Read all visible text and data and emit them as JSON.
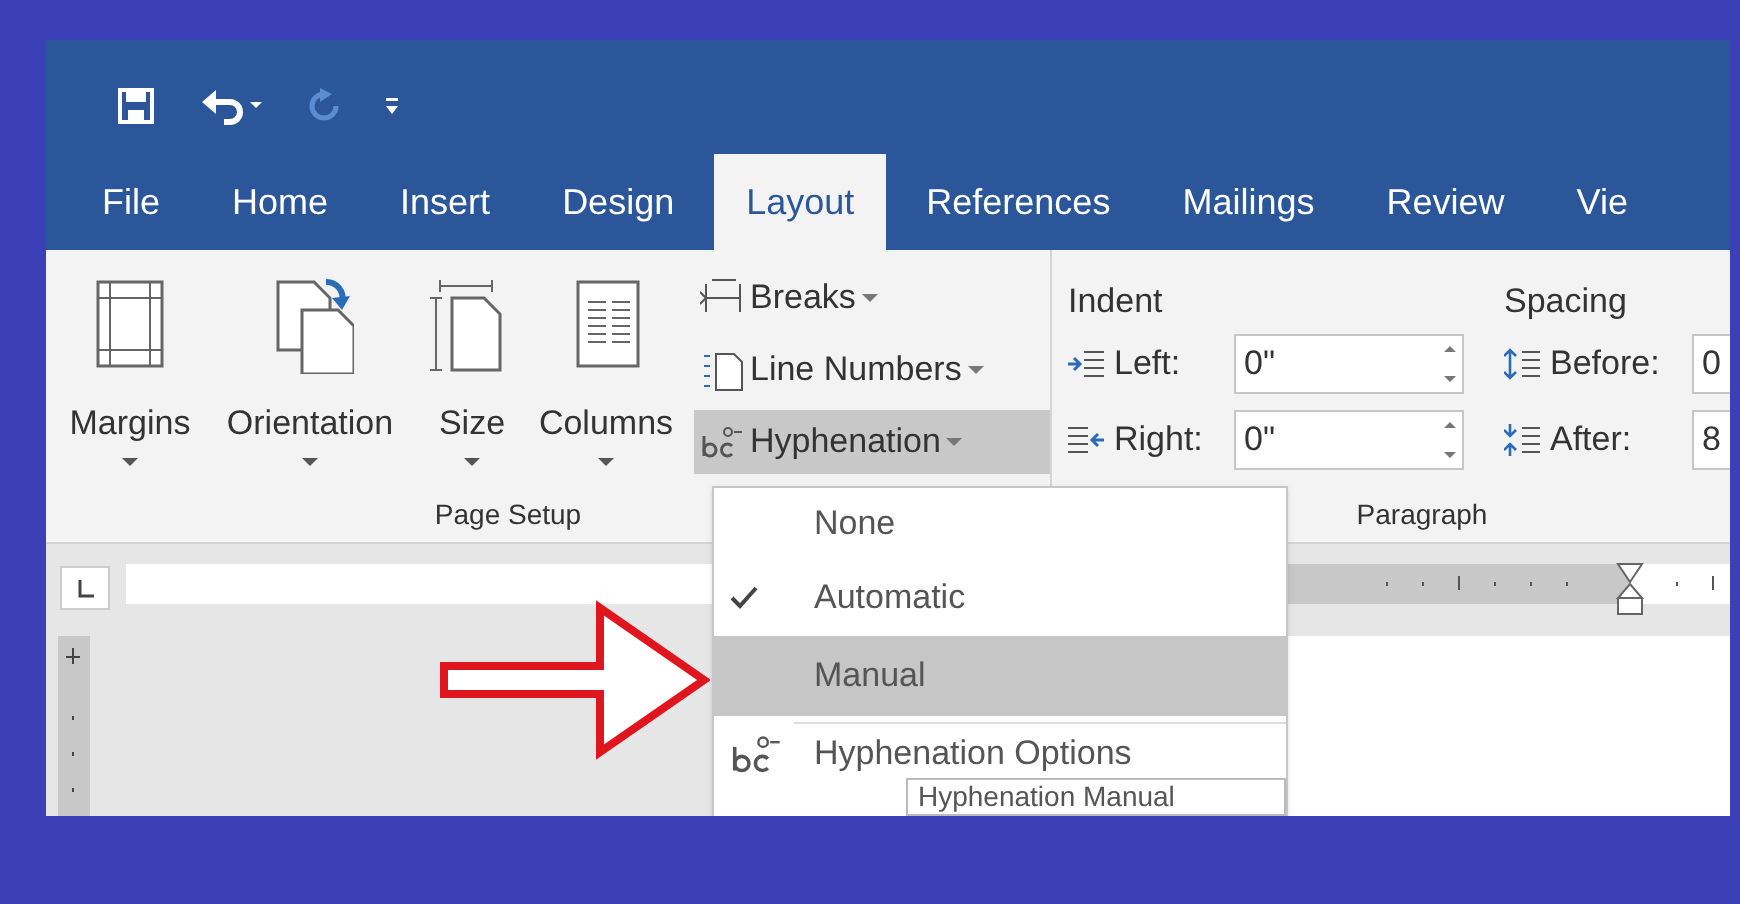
{
  "tabs": [
    {
      "label": "File",
      "selected": false
    },
    {
      "label": "Home",
      "selected": false
    },
    {
      "label": "Insert",
      "selected": false
    },
    {
      "label": "Design",
      "selected": false
    },
    {
      "label": "Layout",
      "selected": true
    },
    {
      "label": "References",
      "selected": false
    },
    {
      "label": "Mailings",
      "selected": false
    },
    {
      "label": "Review",
      "selected": false
    },
    {
      "label": "Vie",
      "selected": false
    }
  ],
  "page_setup": {
    "label": "Page Setup",
    "large_buttons": [
      {
        "kind": "margins",
        "label": "Margins"
      },
      {
        "kind": "orientation",
        "label": "Orientation"
      },
      {
        "kind": "size",
        "label": "Size"
      },
      {
        "kind": "columns",
        "label": "Columns"
      }
    ],
    "small_buttons": [
      {
        "kind": "breaks",
        "label": "Breaks",
        "expanded": false
      },
      {
        "kind": "line_numbers",
        "label": "Line Numbers",
        "expanded": false
      },
      {
        "kind": "hyphenation",
        "label": "Hyphenation",
        "expanded": true
      }
    ]
  },
  "paragraph": {
    "label": "Paragraph",
    "indent": {
      "heading": "Indent",
      "fields": [
        {
          "kind": "left",
          "label": "Left:",
          "value": "0\""
        },
        {
          "kind": "right",
          "label": "Right:",
          "value": "0\""
        }
      ]
    },
    "spacing": {
      "heading": "Spacing",
      "fields": [
        {
          "kind": "before",
          "label": "Before:",
          "value": "0"
        },
        {
          "kind": "after",
          "label": "After:",
          "value": "8"
        }
      ]
    }
  },
  "hyphenation_menu": {
    "items": [
      {
        "kind": "option",
        "label": "None",
        "checked": false,
        "selected": false
      },
      {
        "kind": "option",
        "label": "Automatic",
        "checked": true,
        "selected": false
      },
      {
        "kind": "option",
        "label": "Manual",
        "checked": false,
        "selected": true
      },
      {
        "kind": "command",
        "label": "Hyphenation Options",
        "checked": false,
        "selected": false
      }
    ],
    "tooltip": "Hyphenation Manual"
  }
}
